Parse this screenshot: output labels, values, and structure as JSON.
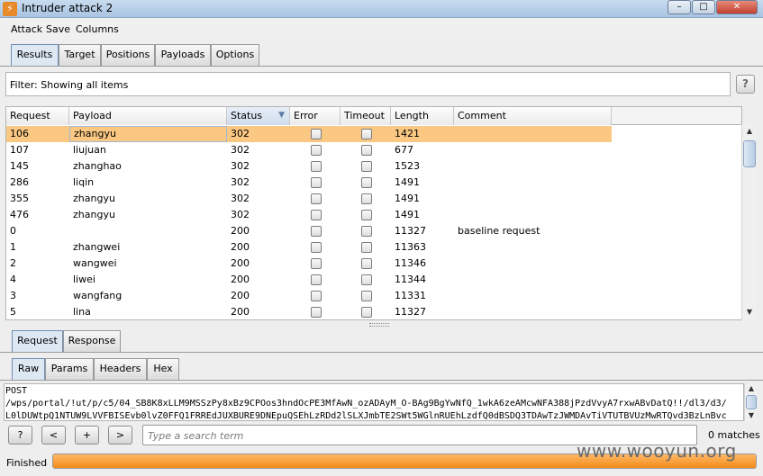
{
  "window": {
    "title": "Intruder attack 2",
    "minimize_glyph": "–",
    "maximize_glyph": "□",
    "close_glyph": "✕",
    "app_icon": "lightning-icon"
  },
  "menu": [
    "Attack",
    "Save",
    "Columns"
  ],
  "main_tabs": [
    "Results",
    "Target",
    "Positions",
    "Payloads",
    "Options"
  ],
  "filter": {
    "text": "Filter:  Showing all items",
    "help": "?"
  },
  "table": {
    "columns": [
      "Request",
      "Payload",
      "Status",
      "Error",
      "Timeout",
      "Length",
      "Comment"
    ],
    "sort_column": "Status",
    "rows": [
      {
        "request": "106",
        "payload": "zhangyu",
        "status": "302",
        "error": false,
        "timeout": false,
        "length": "1421",
        "comment": ""
      },
      {
        "request": "107",
        "payload": "liujuan",
        "status": "302",
        "error": false,
        "timeout": false,
        "length": "677",
        "comment": ""
      },
      {
        "request": "145",
        "payload": "zhanghao",
        "status": "302",
        "error": false,
        "timeout": false,
        "length": "1523",
        "comment": ""
      },
      {
        "request": "286",
        "payload": "liqin",
        "status": "302",
        "error": false,
        "timeout": false,
        "length": "1491",
        "comment": ""
      },
      {
        "request": "355",
        "payload": "zhangyu",
        "status": "302",
        "error": false,
        "timeout": false,
        "length": "1491",
        "comment": ""
      },
      {
        "request": "476",
        "payload": "zhangyu",
        "status": "302",
        "error": false,
        "timeout": false,
        "length": "1491",
        "comment": ""
      },
      {
        "request": "0",
        "payload": "",
        "status": "200",
        "error": false,
        "timeout": false,
        "length": "11327",
        "comment": "baseline request"
      },
      {
        "request": "1",
        "payload": "zhangwei",
        "status": "200",
        "error": false,
        "timeout": false,
        "length": "11363",
        "comment": ""
      },
      {
        "request": "2",
        "payload": "wangwei",
        "status": "200",
        "error": false,
        "timeout": false,
        "length": "11346",
        "comment": ""
      },
      {
        "request": "4",
        "payload": "liwei",
        "status": "200",
        "error": false,
        "timeout": false,
        "length": "11344",
        "comment": ""
      },
      {
        "request": "3",
        "payload": "wangfang",
        "status": "200",
        "error": false,
        "timeout": false,
        "length": "11331",
        "comment": ""
      },
      {
        "request": "5",
        "payload": "lina",
        "status": "200",
        "error": false,
        "timeout": false,
        "length": "11327",
        "comment": ""
      }
    ],
    "selected_row": 0
  },
  "reqresp_tabs": [
    "Request",
    "Response"
  ],
  "view_tabs": [
    "Raw",
    "Params",
    "Headers",
    "Hex"
  ],
  "raw_lines": [
    "POST",
    "/wps/portal/!ut/p/c5/04_SB8K8xLLM9MSSzPy8xBz9CPOos3hndOcPE3MfAwN_ozADAyM_O-BAg9BgYwNfQ_1wkA6zeAMcwNFA388jPzdVvyA7rxwABvDatQ!!/dl3/d3/",
    "L0lDUWtpQ1NTUW9LVVFBISEvb0lvZ0FFQ1FRREdJUXBURE9DNEpuQSEhLzRDd2lSLXJmbTE2SWt5WGlnRUEhLzdfQ0dBSDQ3TDAwTzJWMDAvTiVTUTBVUzMwRTQvd3BzLnBvc"
  ],
  "search": {
    "placeholder": "Type a search term",
    "matches": "0 matches",
    "help": "?",
    "prev": "<",
    "add": "+",
    "next": ">"
  },
  "status": {
    "label": "Finished",
    "progress": 1.0
  },
  "watermark": "www.wooyun.org",
  "colors": {
    "selected_row": "#fbc883",
    "progress": "#f18c1b"
  }
}
